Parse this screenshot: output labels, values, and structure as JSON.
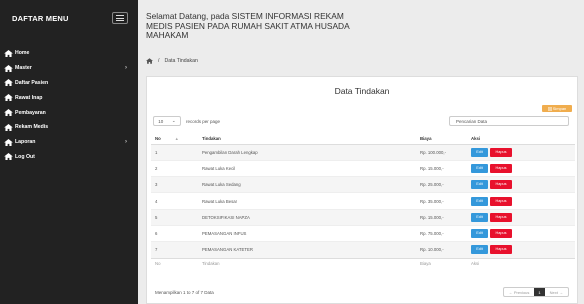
{
  "sidebar": {
    "title": "DAFTAR MENU",
    "items": [
      {
        "label": "Home",
        "arrow": ""
      },
      {
        "label": "Master",
        "arrow": "›"
      },
      {
        "label": "Daftar Pasien",
        "arrow": ""
      },
      {
        "label": "Rawat Inap",
        "arrow": ""
      },
      {
        "label": "Pembayaran",
        "arrow": ""
      },
      {
        "label": "Rekam Medis",
        "arrow": ""
      },
      {
        "label": "Laporan",
        "arrow": "›"
      },
      {
        "label": "Log Out",
        "arrow": ""
      }
    ]
  },
  "header": {
    "title": "Selamat Datang, pada SISTEM INFORMASI REKAM MEDIS PASIEN PADA RUMAH SAKIT ATMA HUSADA MAHAKAM"
  },
  "breadcrumb": {
    "separator": "/",
    "current": "Data Tindakan"
  },
  "panel": {
    "title": "Data Tindakan",
    "export_label": "Simpan",
    "length_value": "10",
    "length_suffix": "records per page",
    "search_label": "Pencarian Data"
  },
  "table": {
    "headers": {
      "no": "No",
      "tindakan": "Tindakan",
      "biaya": "Biaya",
      "aksi": "Aksi"
    },
    "footers": {
      "no": "No",
      "tindakan": "Tindakan",
      "biaya": "Biaya",
      "aksi": "Aksi"
    },
    "rows": [
      {
        "no": "1",
        "tindakan": "Pengambilan Darah Lengkap",
        "biaya": "Rp. 100.000,-"
      },
      {
        "no": "2",
        "tindakan": "Rawat Luka Kecil",
        "biaya": "Rp. 15.000,-"
      },
      {
        "no": "3",
        "tindakan": "Rawat Luka Sedang",
        "biaya": "Rp. 25.000,-"
      },
      {
        "no": "4",
        "tindakan": "Rawat Luka Besar",
        "biaya": "Rp. 35.000,-"
      },
      {
        "no": "5",
        "tindakan": "DETOKSIFIKASI NAPZA",
        "biaya": "Rp. 15.000,-"
      },
      {
        "no": "6",
        "tindakan": "PEMASANGAN INFUS",
        "biaya": "Rp. 75.000,-"
      },
      {
        "no": "7",
        "tindakan": "PEMASANGAN KATETER",
        "biaya": "Rp. 10.000,-"
      }
    ],
    "edit_label": "Edit",
    "delete_label": "Hapus"
  },
  "footer": {
    "info": "Menampilkan 1 to 7 of 7 Data",
    "prev_label": "← Previous",
    "current_page": "1",
    "next_label": "Next →"
  },
  "colors": {
    "sidebar_bg": "#222222",
    "edit_button": "#3498db",
    "delete_button": "#e8112d",
    "export_button": "#f0ad4e"
  }
}
